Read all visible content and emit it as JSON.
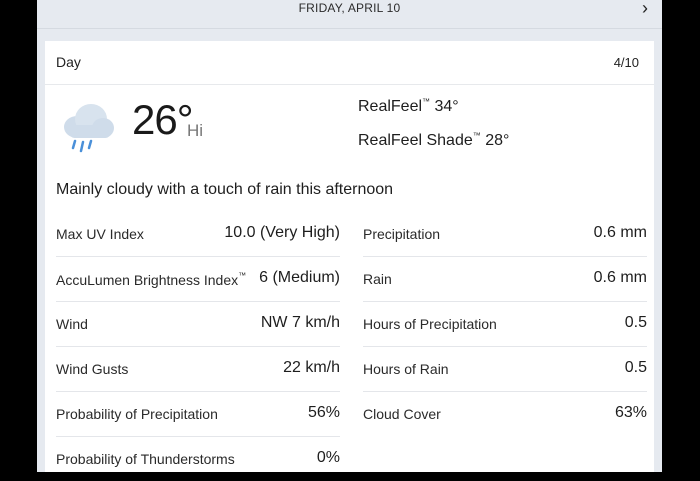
{
  "header": {
    "date": "FRIDAY, APRIL 10",
    "next_icon": "chevron-right-icon"
  },
  "card": {
    "period": "Day",
    "date": "4/10",
    "icon": "cloud-rain-icon",
    "temperature": "26°",
    "temp_label": "Hi",
    "realfeel_label": "RealFeel",
    "realfeel_value": "34°",
    "realfeel_shade_label": "RealFeel Shade",
    "realfeel_shade_value": "28°",
    "phrase": "Mainly cloudy with a touch of rain this afternoon",
    "details_left": [
      {
        "label": "Max UV Index",
        "value": "10.0 (Very High)"
      },
      {
        "label": "AccuLumen Brightness Index",
        "value": "6 (Medium)"
      },
      {
        "label": "Wind",
        "value": "NW 7 km/h"
      },
      {
        "label": "Wind Gusts",
        "value": "22 km/h"
      },
      {
        "label": "Probability of Precipitation",
        "value": "56%"
      },
      {
        "label": "Probability of Thunderstorms",
        "value": "0%"
      }
    ],
    "details_right": [
      {
        "label": "Precipitation",
        "value": "0.6 mm"
      },
      {
        "label": "Rain",
        "value": "0.6 mm"
      },
      {
        "label": "Hours of Precipitation",
        "value": "0.5"
      },
      {
        "label": "Hours of Rain",
        "value": "0.5"
      },
      {
        "label": "Cloud Cover",
        "value": "63%"
      }
    ]
  },
  "colors": {
    "background": "#000000",
    "page": "#e6eaf0",
    "card": "#ffffff",
    "icon_cloud": "#c9d8e6",
    "icon_rain": "#4a90d9"
  }
}
